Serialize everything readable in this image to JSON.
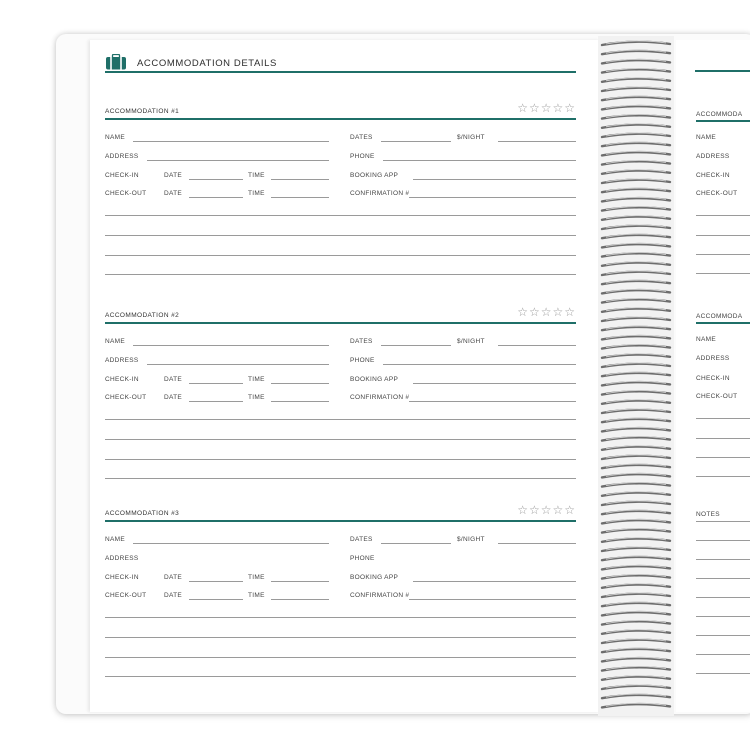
{
  "header": {
    "title": "ACCOMMODATION DETAILS",
    "icon": "suitcase-icon",
    "accent_color": "#1f6f68"
  },
  "stars": "☆☆☆☆☆",
  "labels": {
    "name": "NAME",
    "address": "ADDRESS",
    "check_in": "CHECK-IN",
    "check_out": "CHECK-OUT",
    "date": "DATE",
    "time": "TIME",
    "dates": "DATES",
    "per_night": "$/NIGHT",
    "phone": "PHONE",
    "booking_app": "BOOKING APP",
    "confirmation": "CONFIRMATION #"
  },
  "sections": [
    {
      "title": "ACCOMMODATION #1"
    },
    {
      "title": "ACCOMMODATION #2"
    },
    {
      "title": "ACCOMMODATION #3"
    }
  ],
  "right_page": {
    "section_title_partial": "ACCOMMODA",
    "notes_label": "NOTES"
  }
}
